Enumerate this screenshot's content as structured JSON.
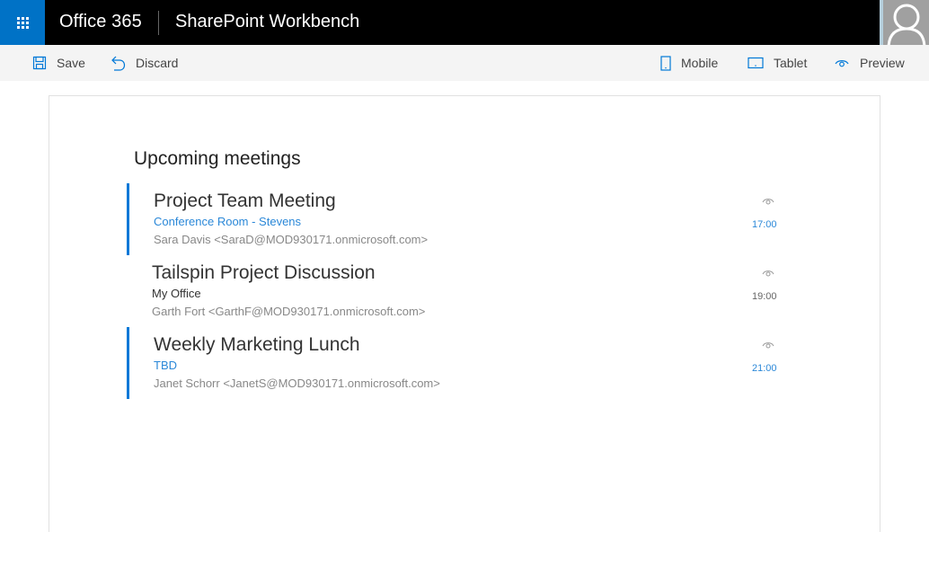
{
  "suite_bar": {
    "brand": "Office 365",
    "app_title": "SharePoint Workbench",
    "accent_color": "#0072c6"
  },
  "command_bar": {
    "left": [
      {
        "label": "Save",
        "icon": "save-icon"
      },
      {
        "label": "Discard",
        "icon": "undo-icon"
      }
    ],
    "right": [
      {
        "label": "Mobile",
        "icon": "mobile-icon"
      },
      {
        "label": "Tablet",
        "icon": "tablet-icon"
      },
      {
        "label": "Preview",
        "icon": "eye-icon"
      }
    ]
  },
  "webpart": {
    "title": "Upcoming meetings",
    "meetings": [
      {
        "subject": "Project Team Meeting",
        "location": "Conference Room - Stevens",
        "organizer": "Sara Davis <SaraD@MOD930171.onmicrosoft.com>",
        "time": "17:00",
        "highlighted": true
      },
      {
        "subject": "Tailspin Project Discussion",
        "location": "My Office",
        "organizer": "Garth Fort <GarthF@MOD930171.onmicrosoft.com>",
        "time": "19:00",
        "highlighted": false
      },
      {
        "subject": "Weekly Marketing Lunch",
        "location": "TBD",
        "organizer": "Janet Schorr <JanetS@MOD930171.onmicrosoft.com>",
        "time": "21:00",
        "highlighted": true
      }
    ]
  },
  "colors": {
    "accent": "#0078d7",
    "link": "#2b88d8"
  }
}
